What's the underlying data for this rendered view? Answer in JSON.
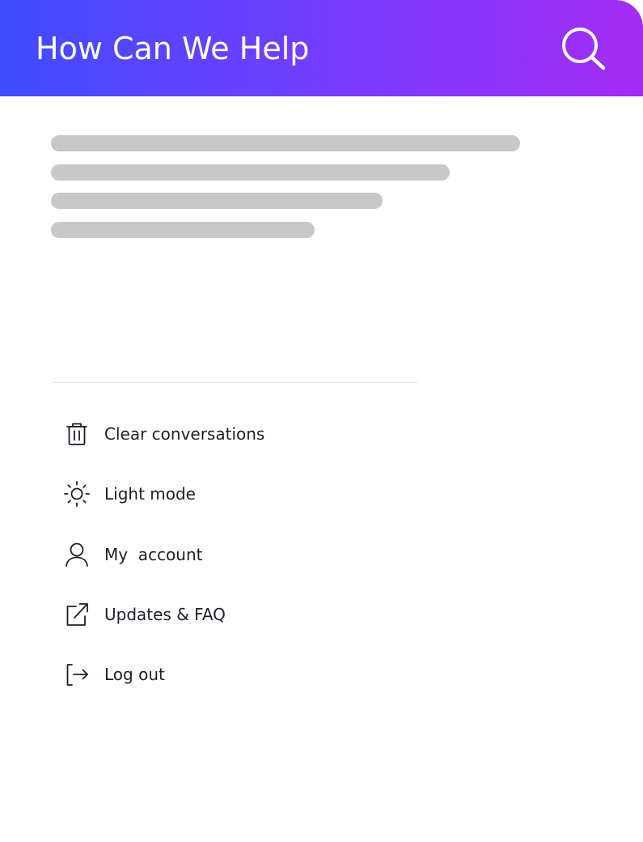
{
  "header": {
    "title": "How Can We Help",
    "search_icon": "search-icon",
    "gradient_start": "#3f4cff",
    "gradient_end": "#a42cf2"
  },
  "skeleton_color": "#c8c8c8",
  "menu": {
    "items": [
      {
        "label": "Clear conversations",
        "icon": "trash-icon"
      },
      {
        "label": "Light mode",
        "icon": "sun-icon"
      },
      {
        "label": "My  account",
        "icon": "user-icon"
      },
      {
        "label": "Updates & FAQ",
        "icon": "external-link-icon"
      },
      {
        "label": "Log out",
        "icon": "logout-icon"
      }
    ]
  }
}
